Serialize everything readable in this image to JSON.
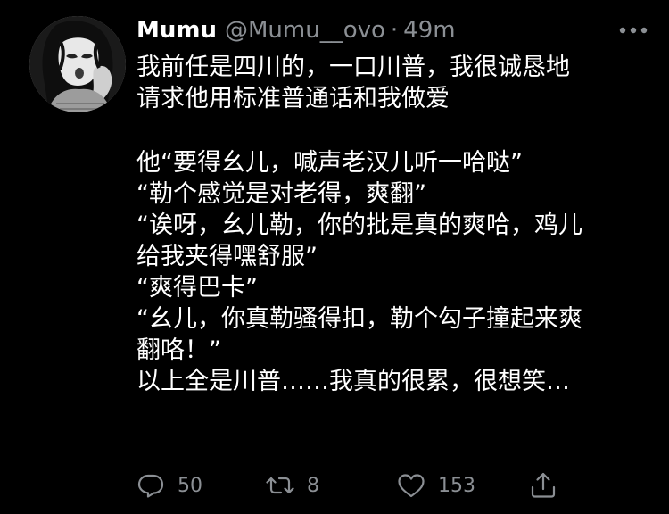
{
  "tweet": {
    "author": {
      "display_name": "Mumu",
      "handle": "@Mumu__ovo",
      "time_separator": "·",
      "time": "49m"
    },
    "lines": [
      "我前任是四川的，一口川普，我很诚恳地",
      "请求他用标准普通话和我做爱",
      "",
      "他“要得幺儿，喊声老汉儿听一哈哒”",
      "“勒个感觉是对老得，爽翻”",
      "“诶呀，幺儿勒，你的批是真的爽哈，鸡儿",
      "给我夹得嘿舒服”",
      "“爽得巴卡”",
      "“幺儿，你真勒骚得扣，勒个勾子撞起来爽",
      "翻咯！”",
      "以上全是川普……我真的很累，很想笑…"
    ],
    "stats": {
      "replies": "50",
      "retweets": "8",
      "likes": "153"
    }
  },
  "icons": {
    "reply": "reply-icon",
    "retweet": "retweet-icon",
    "like": "heart-icon",
    "share": "share-icon",
    "more": "more-options-icon"
  },
  "colors": {
    "background": "#000000",
    "text": "#ffffff",
    "secondary": "#8b8f94"
  }
}
